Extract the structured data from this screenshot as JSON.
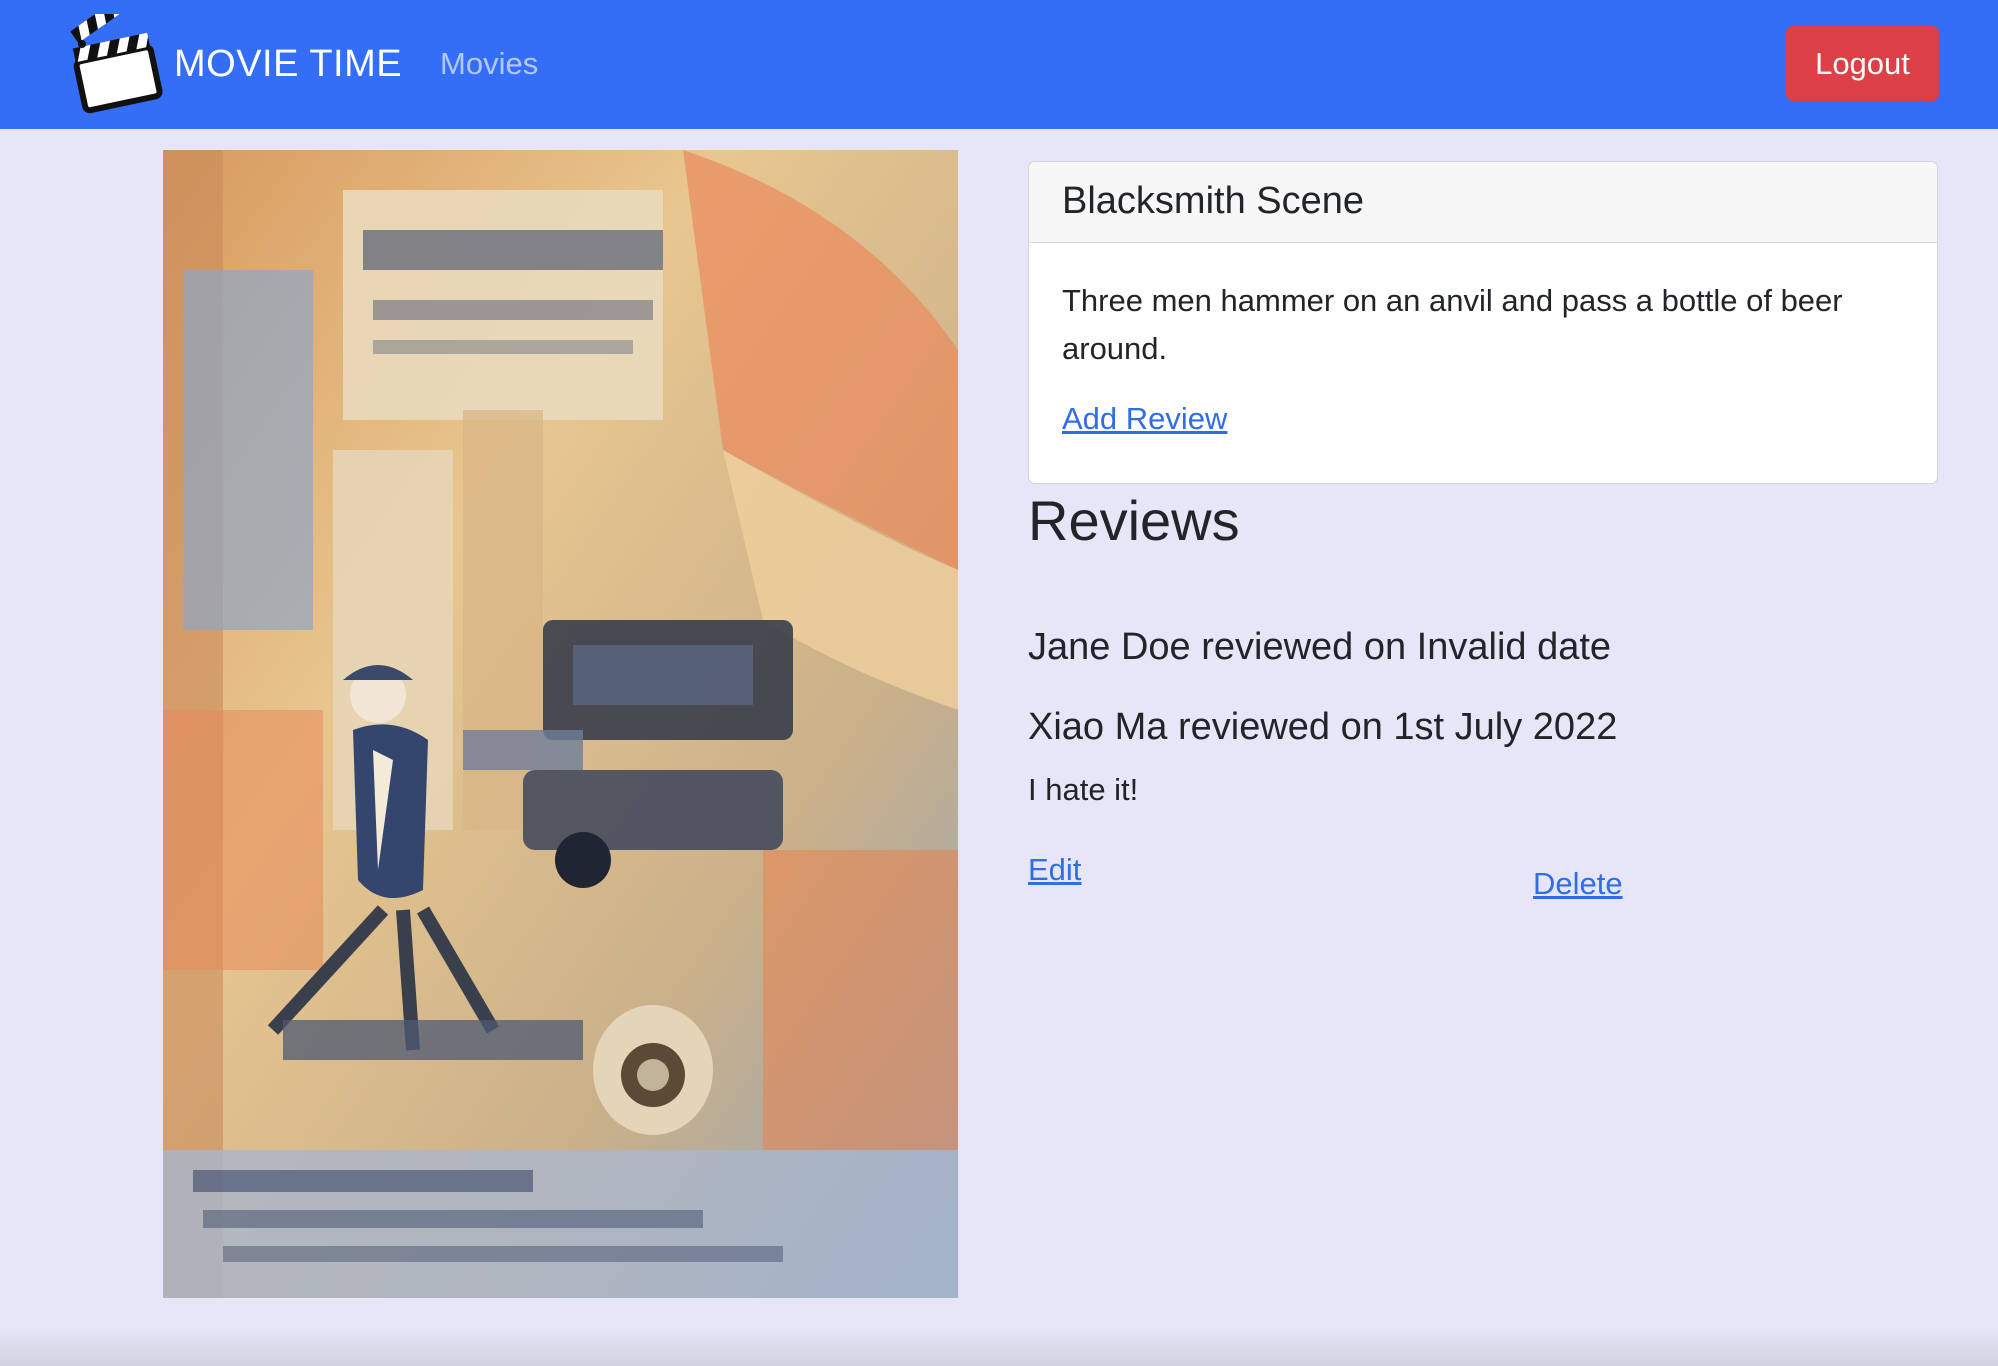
{
  "navbar": {
    "brand": "MOVIE TIME",
    "movies_link": "Movies",
    "logout_label": "Logout",
    "color": "#346ef6"
  },
  "movie": {
    "title": "Blacksmith Scene",
    "plot": "Three men hammer on an anvil and pass a bottle of beer around.",
    "add_review_label": "Add Review",
    "poster_icon": "movie-poster-image"
  },
  "reviews": {
    "title": "Reviews",
    "items": [
      {
        "heading": "Jane Doe reviewed on Invalid date",
        "text": ""
      },
      {
        "heading": "Xiao Ma reviewed on 1st July 2022",
        "text": "I hate it!",
        "edit_label": "Edit",
        "delete_label": "Delete"
      }
    ]
  },
  "colors": {
    "background": "#e6e6f8",
    "logout": "#dc3f46",
    "link": "#2f6ee6"
  }
}
